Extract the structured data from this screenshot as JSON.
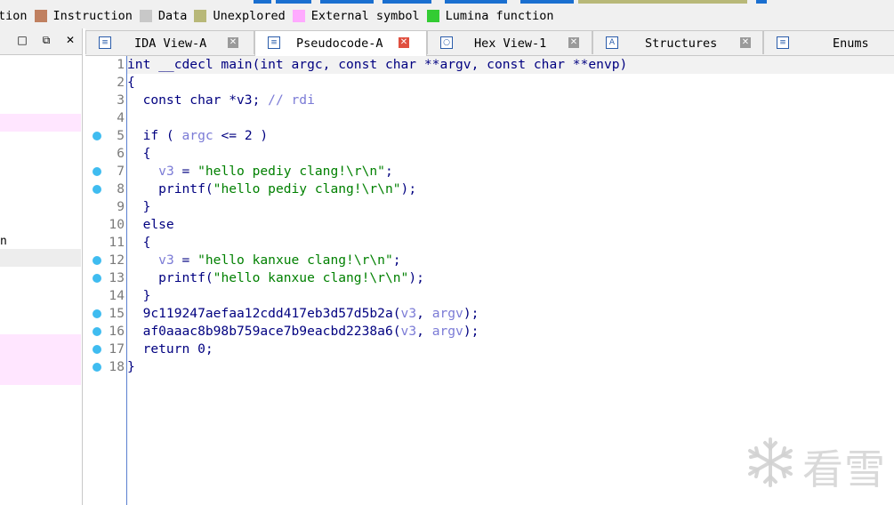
{
  "legend": [
    {
      "label": "tion",
      "color": ""
    },
    {
      "label": "Instruction",
      "color": "#c08060"
    },
    {
      "label": "Data",
      "color": "#c8c8c8"
    },
    {
      "label": "Unexplored",
      "color": "#b8b878"
    },
    {
      "label": "External symbol",
      "color": "#ffaaff"
    },
    {
      "label": "Lumina function",
      "color": "#33cc33"
    }
  ],
  "left_panel": {
    "restore_button": "□",
    "float_button": "⧉",
    "close_button": "✕",
    "fragment_text": "n"
  },
  "tabs": [
    {
      "label": "IDA View-A",
      "icon": "ida-view-icon",
      "active": false,
      "close": "✕"
    },
    {
      "label": "Pseudocode-A",
      "icon": "pseudocode-icon",
      "active": true,
      "close": "✕"
    },
    {
      "label": "Hex View-1",
      "icon": "hex-view-icon",
      "active": false,
      "close": "✕"
    },
    {
      "label": "Structures",
      "icon": "structures-icon",
      "active": false,
      "close": "✕"
    },
    {
      "label": "Enums",
      "icon": "enums-icon",
      "active": false,
      "close": ""
    }
  ],
  "code": {
    "line_numbers": [
      "1",
      "2",
      "3",
      "4",
      "5",
      "6",
      "7",
      "8",
      "9",
      "10",
      "11",
      "12",
      "13",
      "14",
      "15",
      "16",
      "17",
      "18"
    ],
    "breakpoint_lines": [
      5,
      7,
      8,
      12,
      13,
      15,
      16,
      17,
      18
    ],
    "l1": "int __cdecl main(int argc, const char **argv, const char **envp)",
    "l2": "{",
    "l3_a": "  const char *v3; ",
    "l3_b": "// rdi",
    "l4": "",
    "l5_a": "  if ( ",
    "l5_b": "argc",
    "l5_c": " <= 2 )",
    "l6": "  {",
    "l7_a": "    ",
    "l7_b": "v3",
    "l7_c": " = ",
    "l7_d": "\"hello pediy clang!\\r\\n\"",
    "l7_e": ";",
    "l8_a": "    printf(",
    "l8_b": "\"hello pediy clang!\\r\\n\"",
    "l8_c": ");",
    "l9": "  }",
    "l10": "  else",
    "l11": "  {",
    "l12_a": "    ",
    "l12_b": "v3",
    "l12_c": " = ",
    "l12_d": "\"hello kanxue clang!\\r\\n\"",
    "l12_e": ";",
    "l13_a": "    printf(",
    "l13_b": "\"hello kanxue clang!\\r\\n\"",
    "l13_c": ");",
    "l14": "  }",
    "l15_a": "  9c119247aefaa12cdd417eb3d57d5b2a(",
    "l15_b": "v3",
    "l15_c": ", ",
    "l15_d": "argv",
    "l15_e": ");",
    "l16_a": "  af0aaac8b98b759ace7b9eacbd2238a6(",
    "l16_b": "v3",
    "l16_c": ", ",
    "l16_d": "argv",
    "l16_e": ");",
    "l17": "  return 0;",
    "l18": "}"
  },
  "watermark": {
    "text": "看雪",
    "icon": "snowflake-icon"
  }
}
